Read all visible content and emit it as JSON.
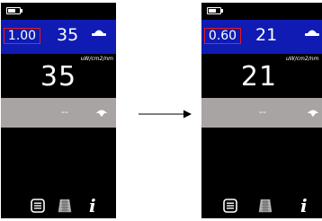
{
  "screens": [
    {
      "factor": "1.00",
      "header_value": "35",
      "unit": "uW/cm2/nm",
      "main_value": "35",
      "secondary_value": "--"
    },
    {
      "factor": "0.60",
      "header_value": "21",
      "unit": "uW/cm2/nm",
      "main_value": "21",
      "secondary_value": "--"
    }
  ],
  "colors": {
    "header_bg": "#0f1bb3",
    "screen_bg": "#000000",
    "secondary_bar": "#a8a4a3",
    "factor_border": "#e41b1b"
  },
  "icons": [
    "battery-icon",
    "sensor-dome-icon",
    "probe-icon",
    "menu-icon",
    "calibration-grid-icon",
    "info-icon",
    "transition-arrow-icon"
  ]
}
